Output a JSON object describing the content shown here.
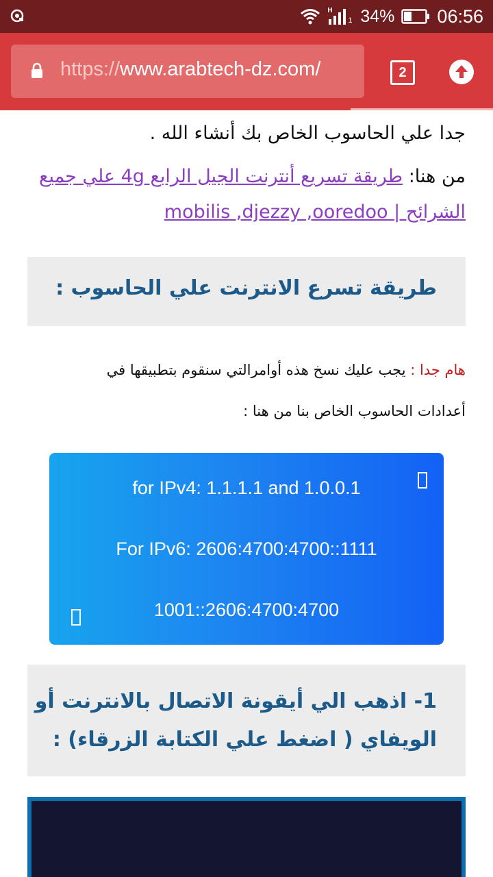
{
  "status_bar": {
    "battery_percent": "34%",
    "time": "06:56",
    "network_label": "H",
    "sim_label": "1",
    "icons": [
      "screen-record-icon",
      "wifi-icon",
      "signal-icon",
      "battery-icon"
    ]
  },
  "browser": {
    "url_scheme": "https://",
    "url_host": "www.arabtech-dz.com/",
    "tab_count": "2",
    "page_load_progress": 0.71
  },
  "article": {
    "para1": "جدا علي الحاسوب الخاص بك أنشاء الله .",
    "para2_prefix": "من هنا: ",
    "para2_link": "طريقة تسريع أنترنت الجيل الرابع 4g علي جميع الشرائح | mobilis ,djezzy ,ooredoo",
    "heading1": "طريقة تسرع الانترنت علي الحاسوب :",
    "important_label": "هام جدا : ",
    "important_text": "يجب عليك نسخ هذه أوامرالتي سنقوم بتطبيقها في",
    "important_line2": "أعدادات الحاسوب الخاص بنا من هنا :",
    "dns_ipv4": "for IPv4: 1.1.1.1 and 1.0.0.1",
    "dns_ipv6": "For IPv6: 2606:4700:4700::1111",
    "dns_ipv6_2": "1001::2606:4700:4700",
    "heading2": "1- اذهب الي أيقونة الاتصال بالانترنت أو الويفاي ( اضغط علي الكتابة الزرقاء) :"
  },
  "colors": {
    "status_bar": "#6f1d1f",
    "toolbar": "#d63a3c",
    "link": "#8b3fc0",
    "heading": "#1c5a8a",
    "important_red": "#c41b1b",
    "dns_gradient_start": "#17a4ee",
    "dns_gradient_end": "#1461f5"
  }
}
